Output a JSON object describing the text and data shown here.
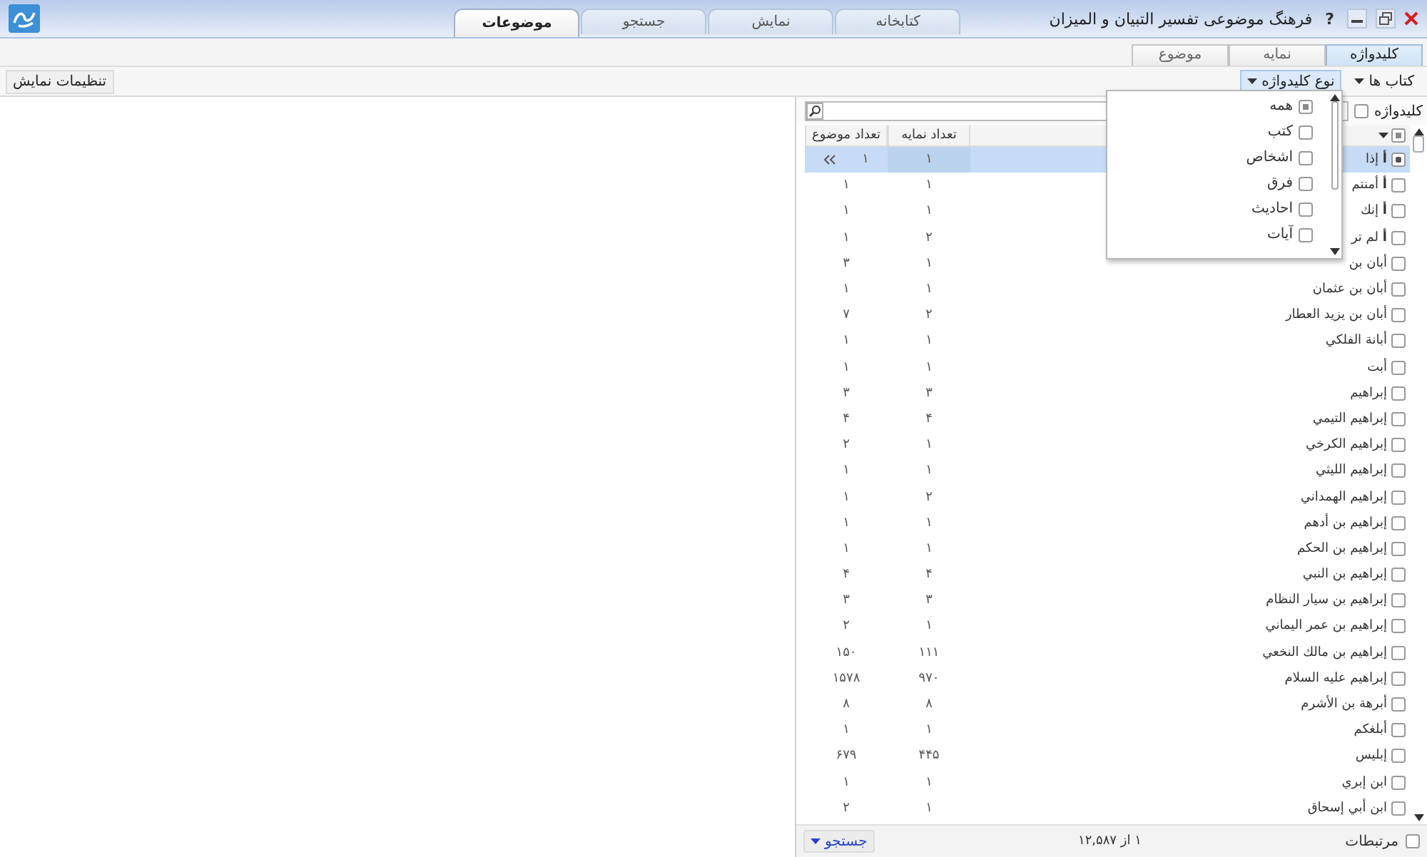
{
  "window": {
    "title": "فرهنگ موضوعی تفسیر التبیان و المیزان",
    "help": "?"
  },
  "main_tabs": [
    {
      "label": "کتابخانه",
      "selected": false
    },
    {
      "label": "نمایش",
      "selected": false
    },
    {
      "label": "جستجو",
      "selected": false
    },
    {
      "label": "موضوعات",
      "selected": true
    }
  ],
  "sub_tabs": [
    {
      "label": "کلیدواژه",
      "selected": true
    },
    {
      "label": "نمایه",
      "selected": false
    },
    {
      "label": "موضوع",
      "selected": false
    }
  ],
  "toolbar": {
    "books_button": "کتاب ها",
    "keyword_type_button": {
      "label": "نوع کلیدواژه",
      "expanded": true
    },
    "display_settings_button": "تنظیمات نمایش"
  },
  "keyword_type_menu": [
    {
      "label": "همه",
      "partial": true
    },
    {
      "label": "کتب",
      "partial": false
    },
    {
      "label": "اشخاص",
      "partial": false
    },
    {
      "label": "فرق",
      "partial": false
    },
    {
      "label": "احادیث",
      "partial": false
    },
    {
      "label": "آیات",
      "partial": false
    }
  ],
  "search": {
    "label": "کلیدواژه",
    "checked": false
  },
  "table": {
    "header_partial": true,
    "columns": [
      "تعداد نمایه",
      "تعداد موضوع"
    ],
    "rows": [
      {
        "name": "**أ** إذا",
        "index_count": "۱",
        "topic_count": "۱",
        "checked": true,
        "selected": true
      },
      {
        "name": "**أ** أمنتم",
        "index_count": "۱",
        "topic_count": "۱",
        "checked": false,
        "selected": false
      },
      {
        "name": "**أ** إنك",
        "index_count": "۱",
        "topic_count": "۱",
        "checked": false,
        "selected": false
      },
      {
        "name": "**أ** لم تر",
        "index_count": "۲",
        "topic_count": "۱",
        "checked": false,
        "selected": false
      },
      {
        "name": "أبان بن",
        "index_count": "۱",
        "topic_count": "۳",
        "checked": false,
        "selected": false
      },
      {
        "name": "أبان بن عثمان",
        "index_count": "۱",
        "topic_count": "۱",
        "checked": false,
        "selected": false
      },
      {
        "name": "أبان بن يزيد العطار",
        "index_count": "۲",
        "topic_count": "۷",
        "checked": false,
        "selected": false
      },
      {
        "name": "أبانة الفلكي",
        "index_count": "۱",
        "topic_count": "۱",
        "checked": false,
        "selected": false
      },
      {
        "name": "أبت",
        "index_count": "۱",
        "topic_count": "۱",
        "checked": false,
        "selected": false
      },
      {
        "name": "إبراهيم",
        "index_count": "۳",
        "topic_count": "۳",
        "checked": false,
        "selected": false
      },
      {
        "name": "إبراهيم التيمي",
        "index_count": "۴",
        "topic_count": "۴",
        "checked": false,
        "selected": false
      },
      {
        "name": "إبراهيم الكرخي",
        "index_count": "۱",
        "topic_count": "۲",
        "checked": false,
        "selected": false
      },
      {
        "name": "إبراهيم الليثي",
        "index_count": "۱",
        "topic_count": "۱",
        "checked": false,
        "selected": false
      },
      {
        "name": "إبراهيم الهمداني",
        "index_count": "۲",
        "topic_count": "۱",
        "checked": false,
        "selected": false
      },
      {
        "name": "إبراهيم بن أدهم",
        "index_count": "۱",
        "topic_count": "۱",
        "checked": false,
        "selected": false
      },
      {
        "name": "إبراهيم بن الحكم",
        "index_count": "۱",
        "topic_count": "۱",
        "checked": false,
        "selected": false
      },
      {
        "name": "إبراهيم بن النبي",
        "index_count": "۴",
        "topic_count": "۴",
        "checked": false,
        "selected": false
      },
      {
        "name": "إبراهيم بن سيار النظام",
        "index_count": "۳",
        "topic_count": "۳",
        "checked": false,
        "selected": false
      },
      {
        "name": "إبراهيم بن عمر اليماني",
        "index_count": "۱",
        "topic_count": "۲",
        "checked": false,
        "selected": false
      },
      {
        "name": "إبراهيم بن مالك النخعي",
        "index_count": "۱۱۱",
        "topic_count": "۱۵۰",
        "checked": false,
        "selected": false
      },
      {
        "name": "إبراهيم عليه السلام",
        "index_count": "۹۷۰",
        "topic_count": "۱۵۷۸",
        "checked": false,
        "selected": false
      },
      {
        "name": "أبرهة بن الأشرم",
        "index_count": "۸",
        "topic_count": "۸",
        "checked": false,
        "selected": false
      },
      {
        "name": "أبلغكم",
        "index_count": "۱",
        "topic_count": "۱",
        "checked": false,
        "selected": false
      },
      {
        "name": "إبليس",
        "index_count": "۴۴۵",
        "topic_count": "۶۷۹",
        "checked": false,
        "selected": false
      },
      {
        "name": "ابن إبري",
        "index_count": "۱",
        "topic_count": "۱",
        "checked": false,
        "selected": false
      },
      {
        "name": "ابن أبي إسحاق",
        "index_count": "۱",
        "topic_count": "۲",
        "checked": false,
        "selected": false
      }
    ]
  },
  "footer": {
    "related": {
      "label": "مرتبطات",
      "checked": false
    },
    "count": "۱ از ۱۲,۵۸۷",
    "search_button": "جستجو"
  }
}
